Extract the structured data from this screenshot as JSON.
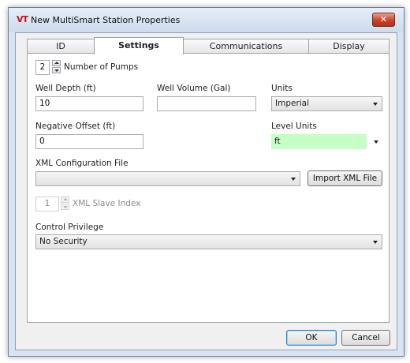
{
  "window": {
    "logo": "VT",
    "title": "New MultiSmart Station Properties",
    "close_glyph": "✕"
  },
  "tabs": [
    {
      "label": "ID",
      "active": false
    },
    {
      "label": "Settings",
      "active": true
    },
    {
      "label": "Communications",
      "active": false
    },
    {
      "label": "Display",
      "active": false
    }
  ],
  "settings": {
    "pumps": {
      "value": "2",
      "label": "Number of Pumps"
    },
    "well_depth": {
      "label": "Well Depth (ft)",
      "value": "10"
    },
    "well_volume": {
      "label": "Well Volume (Gal)",
      "value": ""
    },
    "units": {
      "label": "Units",
      "selected": "Imperial"
    },
    "negative_offset": {
      "label": "Negative Offset (ft)",
      "value": "0"
    },
    "level_units": {
      "label": "Level Units",
      "selected": "ft",
      "highlight_color": "#c6ffc6"
    },
    "xml_config": {
      "label": "XML Configuration File",
      "selected": "",
      "import_label": "Import XML File"
    },
    "xml_slave": {
      "value": "1",
      "label": "XML Slave Index",
      "enabled": false
    },
    "control_privilege": {
      "label": "Control Privilege",
      "selected": "No Security"
    }
  },
  "footer": {
    "ok_label": "OK",
    "cancel_label": "Cancel"
  }
}
